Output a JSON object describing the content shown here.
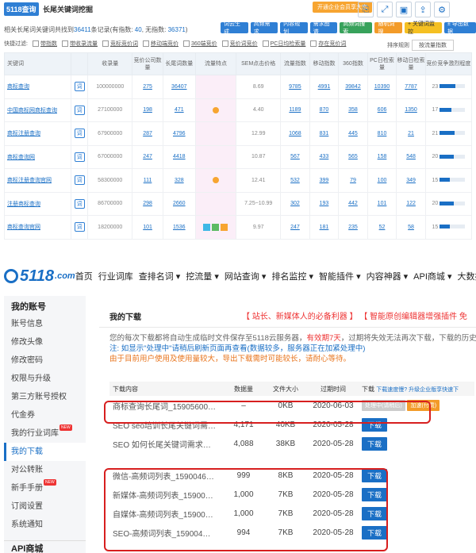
{
  "top": {
    "logo": "5118查询",
    "title": "长尾关键词挖掘",
    "promo": "开通企业会员享大宗",
    "icon_buttons": [
      "copy-icon",
      "expand-icon",
      "save-icon",
      "share-icon",
      "settings-icon"
    ],
    "stats_prefix": "相关长尾词关键词共找到",
    "stats_total": "36411",
    "stats_total_suffix": "条记录(有指数:",
    "stats_indexed": "40",
    "stats_noindex_label": ", 无指数:",
    "stats_noindex": "36371",
    "stats_suffix": ")",
    "actions": [
      {
        "label": "词云生成",
        "style": "blue"
      },
      {
        "label": "高频需求",
        "style": "blue"
      },
      {
        "label": "内容规划",
        "style": "blue"
      },
      {
        "label": "需求图谱",
        "style": "blue"
      },
      {
        "label": "高频词搜索",
        "style": "green"
      },
      {
        "label": "随机词搜",
        "style": "orange"
      },
      {
        "label": "+ 关键词监控",
        "style": "yellow"
      },
      {
        "label": "± 导出数据",
        "style": "blue"
      }
    ],
    "filter_label": "快捷过滤:",
    "filters": [
      "带指数",
      "带收录流量",
      "竞标竞价词",
      "移动端竞价",
      "360端竞价",
      "竞价词竞价",
      "PC日均检索量",
      "存在竞价词"
    ],
    "sort_label": "排序规则",
    "sort_value": "按流量指数",
    "columns": [
      "关键词",
      "",
      "收录量",
      "竞价公司数量",
      "长尾词数量",
      "流量特点",
      "SEM点击价格",
      "流量指数",
      "移动指数",
      "360指数",
      "PC日检索量",
      "移动日检索量",
      "竞价竞争激烈程度"
    ],
    "rows": [
      {
        "kw": "商标查询",
        "sel": "词",
        "indexed": "100000000",
        "bid": "275",
        "long": "36407",
        "flow": "",
        "sem": "8.69",
        "fi": "9785",
        "mi": "4991",
        "i360": "39842",
        "pc": "10390",
        "mob": "7787",
        "comp": "23",
        "bar": 0.62
      },
      {
        "kw": "中国商标网商标查询",
        "sel": "词",
        "indexed": "27100000",
        "bid": "198",
        "long": "471",
        "flow": "dot",
        "sem": "4.40",
        "fi": "1189",
        "mi": "870",
        "i360": "358",
        "pc": "606",
        "mob": "1350",
        "comp": "17",
        "bar": 0.46
      },
      {
        "kw": "商标注册查询",
        "sel": "词",
        "indexed": "67900000",
        "bid": "287",
        "long": "4796",
        "flow": "",
        "sem": "12.99",
        "fi": "1068",
        "mi": "831",
        "i360": "445",
        "pc": "810",
        "mob": "21",
        "comp": "21",
        "bar": 0.57
      },
      {
        "kw": "商标查询网",
        "sel": "词",
        "indexed": "67000000",
        "bid": "247",
        "long": "4418",
        "flow": "",
        "sem": "10.87",
        "fi": "567",
        "mi": "433",
        "i360": "565",
        "pc": "158",
        "mob": "548",
        "comp": "20",
        "bar": 0.54
      },
      {
        "kw": "商标注册查询官网",
        "sel": "词",
        "indexed": "58300000",
        "bid": "111",
        "long": "328",
        "flow": "dot",
        "sem": "12.41",
        "fi": "532",
        "mi": "399",
        "i360": "79",
        "pc": "100",
        "mob": "349",
        "comp": "15",
        "bar": 0.41
      },
      {
        "kw": "注册商标查询",
        "sel": "词",
        "indexed": "86700000",
        "bid": "298",
        "long": "2660",
        "flow": "",
        "sem": "7.25~10.99",
        "fi": "302",
        "mi": "193",
        "i360": "442",
        "pc": "101",
        "mob": "122",
        "comp": "20",
        "bar": 0.54
      },
      {
        "kw": "商标查询官网",
        "sel": "词",
        "indexed": "18200000",
        "bid": "101",
        "long": "1536",
        "flow": "tags",
        "sem": "9.97",
        "fi": "247",
        "mi": "181",
        "i360": "235",
        "pc": "52",
        "mob": "58",
        "comp": "15",
        "bar": 0.41
      }
    ]
  },
  "bottom": {
    "logo_main": "5118",
    "logo_suffix": ".com",
    "nav": [
      "首页",
      "行业词库",
      "查排名词 ▾",
      "挖流量 ▾",
      "网站查询 ▾",
      "排名监控 ▾",
      "智能插件 ▾",
      "内容神器 ▾",
      "API商城 ▾",
      "大数据服务"
    ],
    "sidebar_title": "我的账号",
    "sidebar_items": [
      {
        "label": "账号信息",
        "new": false,
        "active": false
      },
      {
        "label": "修改头像",
        "new": false,
        "active": false
      },
      {
        "label": "修改密码",
        "new": false,
        "active": false
      },
      {
        "label": "权限与升级",
        "new": false,
        "active": false
      },
      {
        "label": "第三方账号授权",
        "new": false,
        "active": false
      },
      {
        "label": "代金券",
        "new": false,
        "active": false
      },
      {
        "label": "我的行业词库",
        "new": true,
        "active": false
      },
      {
        "label": "我的下载",
        "new": false,
        "active": true
      },
      {
        "label": "对公转账",
        "new": false,
        "active": false
      },
      {
        "label": "新手手册",
        "new": true,
        "active": false
      },
      {
        "label": "订阅设置",
        "new": false,
        "active": false
      },
      {
        "label": "系统通知",
        "new": false,
        "active": false
      }
    ],
    "new_badge": "NEW",
    "sidebar_section2": "API商城",
    "tab": "我的下载",
    "promo1": "【 站长、新媒体人的必备利器 】",
    "promo2": "【 智能原创编辑器增强插件 免",
    "notice1_a": "您的每次下载都将自动生成临时文件保存至5118云服务器，",
    "notice1_b": "有效期7天",
    "notice1_c": "，过期将失效无法再次下载，下载的历史",
    "notice2": "注: 如显示\"处理中\"请稍后刷新页面再查看(数据较多，服务器正在加紧处理中)",
    "notice3": "由于目前用户使用及使用量较大，导出下载需时可能较长，请耐心等待。",
    "table_headers": [
      "下载内容",
      "数据量",
      "文件大小",
      "过期时间",
      "下载"
    ],
    "header_note": "下载速度慢? 升级企业版享快速下",
    "downloads": [
      {
        "name": "商标查询长尾词_15905600…",
        "count": "–",
        "size": "0KB",
        "expire": "2020-06-03",
        "btn": "processing",
        "btn_label": "处理中(请稍后)",
        "extra": "加速(付费)"
      },
      {
        "name": "SEO seo培训长尾关键词需…",
        "count": "4,171",
        "size": "40KB",
        "expire": "2020-05-28",
        "btn": "download",
        "btn_label": "下载"
      },
      {
        "name": "SEO 如何长尾关键词需求…",
        "count": "4,088",
        "size": "38KB",
        "expire": "2020-05-28",
        "btn": "download",
        "btn_label": "下载"
      },
      {
        "name": "微信-高频词列表_1590046…",
        "count": "999",
        "size": "8KB",
        "expire": "2020-05-28",
        "btn": "download",
        "btn_label": "下载"
      },
      {
        "name": "新媒体-高频词列表_15900…",
        "count": "1,000",
        "size": "7KB",
        "expire": "2020-05-28",
        "btn": "download",
        "btn_label": "下载"
      },
      {
        "name": "自媒体-高频词列表_15900…",
        "count": "1,000",
        "size": "7KB",
        "expire": "2020-05-28",
        "btn": "download",
        "btn_label": "下载"
      },
      {
        "name": "SEO-高频词列表_159004…",
        "count": "994",
        "size": "7KB",
        "expire": "2020-05-28",
        "btn": "download",
        "btn_label": "下载"
      }
    ]
  },
  "colors": {
    "brand": "#1a6fc5",
    "highlight": "#d71f1f",
    "accent": "#f39b28"
  }
}
